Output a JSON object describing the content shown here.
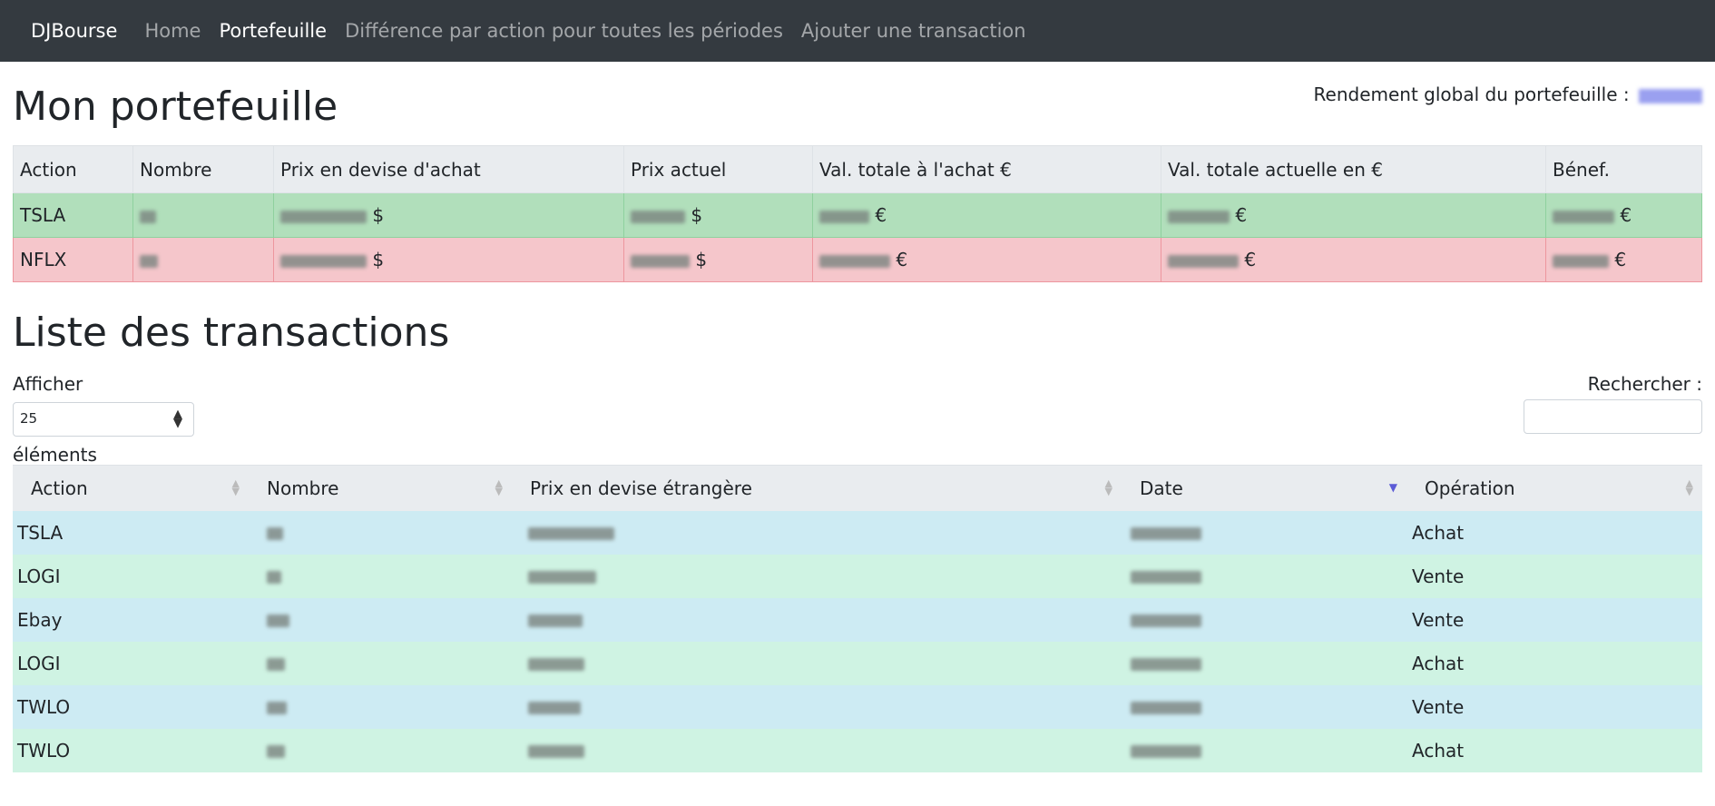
{
  "nav": {
    "brand": "DJBourse",
    "links": [
      "Home",
      "Portefeuille",
      "Différence par action pour toutes les périodes",
      "Ajouter une transaction"
    ]
  },
  "portfolio": {
    "title": "Mon portefeuille",
    "yield_label": "Rendement global du portefeuille :",
    "columns": [
      "Action",
      "Nombre",
      "Prix en devise d'achat",
      "Prix actuel",
      "Val. totale à l'achat €",
      "Val. totale actuelle en €",
      "Bénef."
    ],
    "rows": [
      {
        "action": "TSLA",
        "price_unit": "$",
        "current_unit": "$",
        "buy_total_unit": "€",
        "current_total_unit": "€",
        "profit_unit": "€"
      },
      {
        "action": "NFLX",
        "price_unit": "$",
        "current_unit": "$",
        "buy_total_unit": "€",
        "current_total_unit": "€",
        "profit_unit": "€"
      }
    ]
  },
  "transactions": {
    "title": "Liste des transactions",
    "show_label": "Afficher",
    "page_length": "25",
    "elements_label": "éléments",
    "search_label": "Rechercher :",
    "columns": [
      "Action",
      "Nombre",
      "Prix en devise étrangère",
      "Date",
      "Opération"
    ],
    "rows": [
      {
        "action": "TSLA",
        "operation": "Achat"
      },
      {
        "action": "LOGI",
        "operation": "Vente"
      },
      {
        "action": "Ebay",
        "operation": "Vente"
      },
      {
        "action": "LOGI",
        "operation": "Achat"
      },
      {
        "action": "TWLO",
        "operation": "Vente"
      },
      {
        "action": "TWLO",
        "operation": "Achat"
      }
    ]
  },
  "colors": {
    "navbar": "#343a40",
    "gain_row": "#b1dfbb",
    "loss_row": "#f5c6cb",
    "row_odd": "#cdebf3",
    "row_even": "#cff3e3"
  }
}
